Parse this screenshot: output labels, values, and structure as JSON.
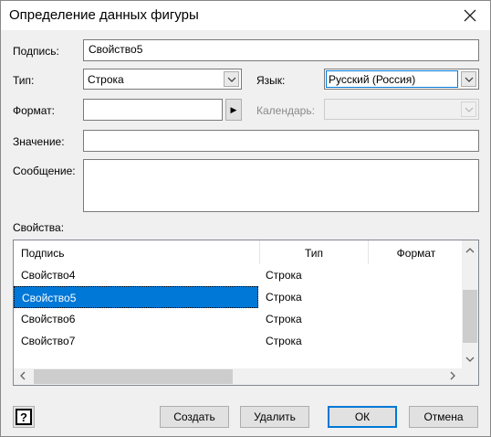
{
  "window": {
    "title": "Определение данных фигуры",
    "close_icon": "close-icon"
  },
  "form": {
    "label_caption": "Подпись:",
    "label_value": "Свойство5",
    "type_caption": "Тип:",
    "type_value": "Строка",
    "language_caption": "Язык:",
    "language_value": "Русский (Россия)",
    "format_caption": "Формат:",
    "format_value": "",
    "format_button_glyph": "▶",
    "calendar_caption": "Календарь:",
    "calendar_value": "",
    "value_caption": "Значение:",
    "value_value": "",
    "message_caption": "Сообщение:",
    "message_value": ""
  },
  "properties": {
    "caption": "Свойства:",
    "columns": [
      "Подпись",
      "Тип",
      "Формат"
    ],
    "rows": [
      {
        "label": "Свойство4",
        "type": "Строка",
        "format": ""
      },
      {
        "label": "Свойство5",
        "type": "Строка",
        "format": "",
        "selected": true
      },
      {
        "label": "Свойство6",
        "type": "Строка",
        "format": ""
      },
      {
        "label": "Свойство7",
        "type": "Строка",
        "format": ""
      }
    ]
  },
  "buttons": {
    "create": "Создать",
    "delete": "Удалить",
    "ok": "ОК",
    "cancel": "Отмена"
  },
  "colors": {
    "selection": "#0078d7",
    "window_bg": "#f0f0f0"
  }
}
